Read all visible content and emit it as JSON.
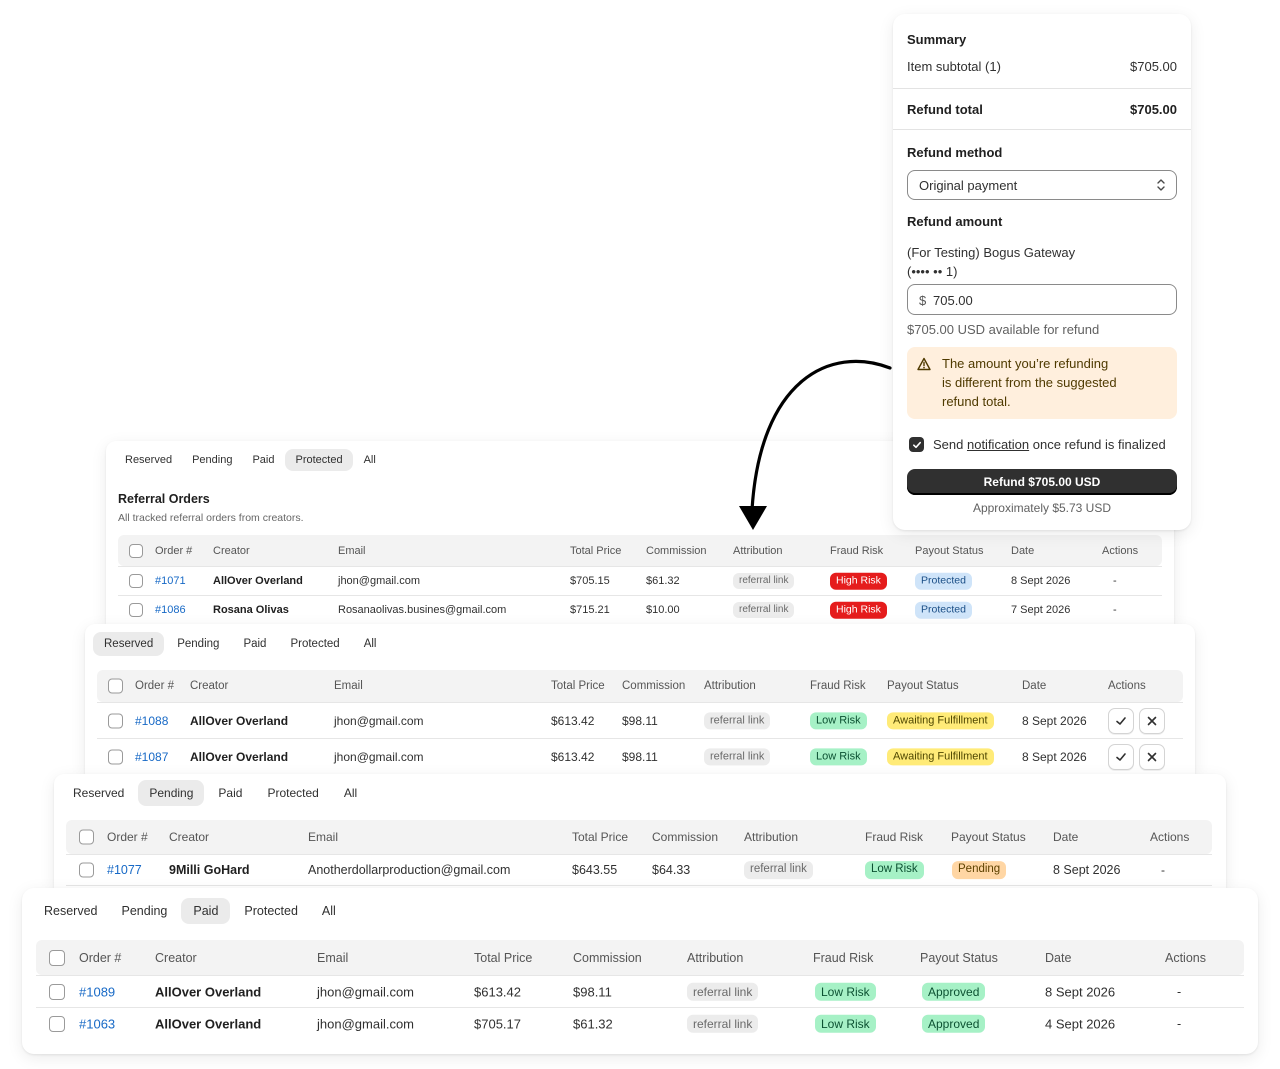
{
  "summary": {
    "heading": "Summary",
    "item_subtotal_label": "Item subtotal (1)",
    "item_subtotal_value": "$705.00",
    "refund_total_label": "Refund total",
    "refund_total_value": "$705.00",
    "refund_method_label": "Refund method",
    "refund_method_value": "Original payment",
    "refund_amount_label": "Refund amount",
    "gateway_line1": "(For Testing) Bogus Gateway",
    "gateway_line2": "(•••• •• 1)",
    "currency_symbol": "$",
    "amount_value": "705.00",
    "available_text": "$705.00 USD available for refund",
    "warning_lines": [
      "The amount you’re refunding",
      "is different from the suggested",
      "refund total."
    ],
    "notify_prefix": "Send ",
    "notify_link": "notification",
    "notify_suffix": " once refund is finalized",
    "refund_button": "Refund $705.00 USD",
    "approx_text": "Approximately $5.73 USD"
  },
  "panel_protected": {
    "tabs": [
      "Reserved",
      "Pending",
      "Paid",
      "Protected",
      "All"
    ],
    "active_tab": "Protected",
    "title": "Referral Orders",
    "subtitle": "All tracked referral orders from creators.",
    "columns": [
      "Order #",
      "Creator",
      "Email",
      "Total Price",
      "Commission",
      "Attribution",
      "Fraud Risk",
      "Payout Status",
      "Date",
      "Actions"
    ],
    "rows": [
      {
        "order": "#1071",
        "creator": "AllOver Overland",
        "email": "jhon@gmail.com",
        "total": "$705.15",
        "commission": "$61.32",
        "attribution": "referral link",
        "fraud": "High Risk",
        "payout": "Protected",
        "date": "8 Sept 2026",
        "actions": "-"
      },
      {
        "order": "#1086",
        "creator": "Rosana Olivas",
        "email": "Rosanaolivas.busines@gmail.com",
        "total": "$715.21",
        "commission": "$10.00",
        "attribution": "referral link",
        "fraud": "High Risk",
        "payout": "Protected",
        "date": "7 Sept 2026",
        "actions": "-"
      }
    ]
  },
  "panel_reserved": {
    "tabs": [
      "Reserved",
      "Pending",
      "Paid",
      "Protected",
      "All"
    ],
    "active_tab": "Reserved",
    "columns": [
      "Order #",
      "Creator",
      "Email",
      "Total Price",
      "Commission",
      "Attribution",
      "Fraud Risk",
      "Payout Status",
      "Date",
      "Actions"
    ],
    "rows": [
      {
        "order": "#1088",
        "creator": "AllOver Overland",
        "email": "jhon@gmail.com",
        "total": "$613.42",
        "commission": "$98.11",
        "attribution": "referral link",
        "fraud": "Low Risk",
        "payout": "Awaiting Fulfillment",
        "date": "8 Sept 2026"
      },
      {
        "order": "#1087",
        "creator": "AllOver Overland",
        "email": "jhon@gmail.com",
        "total": "$613.42",
        "commission": "$98.11",
        "attribution": "referral link",
        "fraud": "Low Risk",
        "payout": "Awaiting Fulfillment",
        "date": "8 Sept 2026"
      }
    ]
  },
  "panel_pending": {
    "tabs": [
      "Reserved",
      "Pending",
      "Paid",
      "Protected",
      "All"
    ],
    "active_tab": "Pending",
    "columns": [
      "Order #",
      "Creator",
      "Email",
      "Total Price",
      "Commission",
      "Attribution",
      "Fraud Risk",
      "Payout Status",
      "Date",
      "Actions"
    ],
    "rows": [
      {
        "order": "#1077",
        "creator": "9Milli GoHard",
        "email": "Anotherdollarproduction@gmail.com",
        "total": "$643.55",
        "commission": "$64.33",
        "attribution": "referral link",
        "fraud": "Low Risk",
        "payout": "Pending",
        "date": "8 Sept 2026",
        "actions": "-"
      }
    ]
  },
  "panel_paid": {
    "tabs": [
      "Reserved",
      "Pending",
      "Paid",
      "Protected",
      "All"
    ],
    "active_tab": "Paid",
    "columns": [
      "Order #",
      "Creator",
      "Email",
      "Total Price",
      "Commission",
      "Attribution",
      "Fraud Risk",
      "Payout Status",
      "Date",
      "Actions"
    ],
    "rows": [
      {
        "order": "#1089",
        "creator": "AllOver Overland",
        "email": "jhon@gmail.com",
        "total": "$613.42",
        "commission": "$98.11",
        "attribution": "referral link",
        "fraud": "Low Risk",
        "payout": "Approved",
        "date": "8 Sept 2026",
        "actions": "-"
      },
      {
        "order": "#1063",
        "creator": "AllOver Overland",
        "email": "jhon@gmail.com",
        "total": "$705.17",
        "commission": "$61.32",
        "attribution": "referral link",
        "fraud": "Low Risk",
        "payout": "Approved",
        "date": "4 Sept 2026",
        "actions": "-"
      }
    ]
  },
  "colors": {
    "high_risk": "#e51c1c",
    "low_risk": "#a6f1c6",
    "protected": "#cfe4f9",
    "awaiting": "#ffeb78",
    "pending": "#ffd6a4",
    "link": "#1769c6",
    "primary_button": "#303030",
    "warning_bg": "#ffefdd"
  },
  "icons": {
    "warning": "warning-triangle-icon",
    "select": "select-chevrons-icon",
    "check": "checkmark-icon",
    "close": "close-icon",
    "arrow": "curved-arrow-icon"
  }
}
